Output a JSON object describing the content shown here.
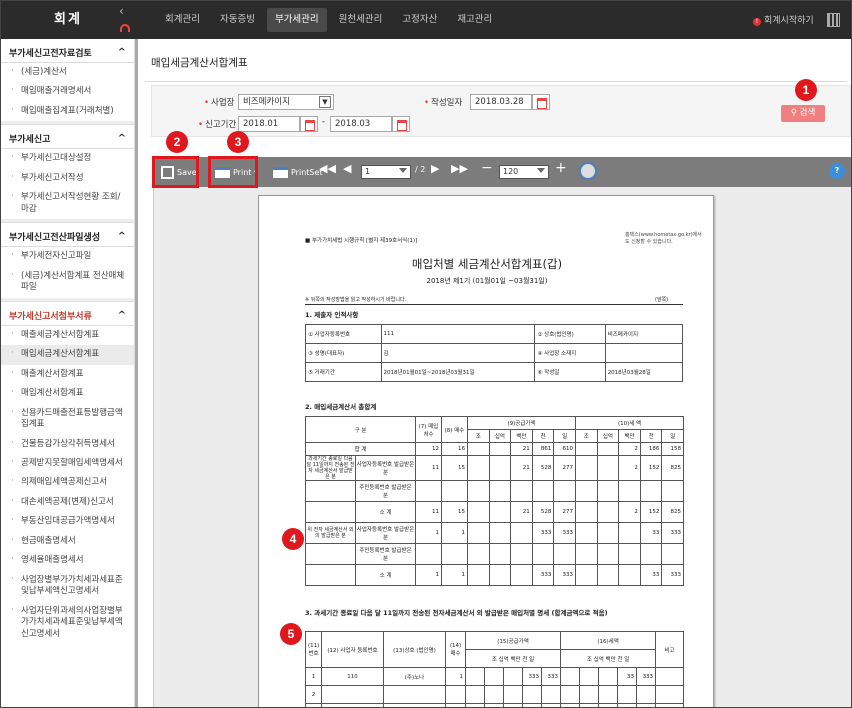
{
  "app": {
    "logo": "회계",
    "start_label": "회계시작하기"
  },
  "topnav": [
    {
      "label": "회계관리"
    },
    {
      "label": "자동증빙"
    },
    {
      "label": "부가세관리"
    },
    {
      "label": "원천세관리"
    },
    {
      "label": "고정자산"
    },
    {
      "label": "재고관리"
    }
  ],
  "topnav_active": "부가세관리",
  "sidebar": [
    {
      "title": "부가세신고전자료검토",
      "items": [
        "(세금)계산서",
        "매입매출거래명세서",
        "매입매출집계표(거래처별)"
      ]
    },
    {
      "title": "부가세신고",
      "items": [
        "부가세신고대상설정",
        "부가세신고서작성",
        "부가세신고서작성현황 조회/마감"
      ]
    },
    {
      "title": "부가세신고전산파일생성",
      "items": [
        "부가세전자신고파일",
        "(세금)계산서합계표 전산매체파일"
      ]
    },
    {
      "title": "부가세신고서첨부서류",
      "items": [
        "매출세금계산서합계표",
        "매입세금계산서합계표",
        "매출계산서합계표",
        "매입계산서합계표",
        "신용카드매출전표등발행금액집계표",
        "건물등감가상각취득명세서",
        "공제받지못할매입세액명세서",
        "의제매입세액공제신고서",
        "대손세액공제(변제)신고서",
        "부동산임대공급가액명세서",
        "현금매출명세서",
        "영세율매출명세서",
        "사업장별부가가치세과세표준및납부세액신고명세서",
        "사업자단위과세의사업장별부가가치세과세표준및납부세액신고명세서"
      ]
    }
  ],
  "sidebar_active": "매입세금계산서합계표",
  "page_title": "매입세금계산서합계표",
  "filter": {
    "business_label": "사업장",
    "business_value": "비즈메카이지",
    "date_label": "작성일자",
    "date_value": "2018.03.28",
    "period_label": "신고기간",
    "period_from": "2018.01",
    "period_to": "2018.03",
    "search_label": "검색"
  },
  "viewer": {
    "save_label": "Save",
    "print_label": "Print",
    "printset_label": "PrintSet",
    "page_value": "1",
    "page_total": "/ 2",
    "zoom_value": "120"
  },
  "markers": [
    "1",
    "2",
    "3",
    "4",
    "5"
  ],
  "doc": {
    "law": "■ 부가가치세법 시행규칙 [별지 제39호서식(1)]",
    "hometax": "홈택스(www.hometax.go.kr)에서도 신청할 수 있습니다.",
    "title": "매입처별 세금계산서합계표(갑)",
    "subtitle": "2018년 제1기 (01월01일 ~03월31일)",
    "note": "※ 뒤쪽의 작성방법을 읽고 작성하시기 바랍니다.",
    "page": "(앞쪽)",
    "sec1": "1. 제출자 인적사항",
    "r1": [
      "① 사업자등록번호",
      "111",
      "② 상호(법인명)",
      "비즈메카이지"
    ],
    "r2": [
      "③ 성명(대표자)",
      "김",
      "④ 사업장 소재지",
      ""
    ],
    "r3": [
      "⑤ 거래기간",
      "2018년01월01일~2018년03월31일",
      "⑥ 작성일",
      "2018년03월28일"
    ],
    "sec2": "2. 매입세금계산서 총합계",
    "h_gubun": "구 분",
    "h7": "(7) 매입 처수",
    "h8": "(8) 매수",
    "h9": "(9)공급가액",
    "h10": "(10)세 액",
    "units": [
      "조",
      "십억",
      "백만",
      "천",
      "일",
      "조",
      "십억",
      "백만",
      "천",
      "일"
    ],
    "total_label": "합 계",
    "g1": "과세기간 종료일 다음 달 11일까지 전송된 전자 세금계산서 발급받은 분",
    "g2": "위 전자 세금계산서 외의 발급받은 분",
    "sub_a": "사업자등록번호 발급받은 분",
    "sub_b": "주민등록번호 발급받은 분",
    "sub_c": "소 계",
    "rows": [
      {
        "c7": "12",
        "c8": "16",
        "v": [
          "",
          "",
          "21",
          "861",
          "610"
        ],
        "t": [
          "",
          "",
          "2",
          "186",
          "158"
        ]
      },
      {
        "c7": "11",
        "c8": "15",
        "v": [
          "",
          "",
          "21",
          "528",
          "277"
        ],
        "t": [
          "",
          "",
          "2",
          "152",
          "825"
        ]
      },
      {
        "c7": "",
        "c8": "",
        "v": [
          "",
          "",
          "",
          "",
          ""
        ],
        "t": [
          "",
          "",
          "",
          "",
          ""
        ]
      },
      {
        "c7": "11",
        "c8": "15",
        "v": [
          "",
          "",
          "21",
          "528",
          "277"
        ],
        "t": [
          "",
          "",
          "2",
          "152",
          "825"
        ]
      },
      {
        "c7": "1",
        "c8": "1",
        "v": [
          "",
          "",
          "",
          "333",
          "333"
        ],
        "t": [
          "",
          "",
          "",
          "33",
          "333"
        ]
      },
      {
        "c7": "",
        "c8": "",
        "v": [
          "",
          "",
          "",
          "",
          ""
        ],
        "t": [
          "",
          "",
          "",
          "",
          ""
        ]
      },
      {
        "c7": "1",
        "c8": "1",
        "v": [
          "",
          "",
          "",
          "333",
          "333"
        ],
        "t": [
          "",
          "",
          "",
          "33",
          "333"
        ]
      }
    ],
    "sec3": "3. 과세기간 종료일 다음 달 11일까지 전송된 전자세금계산서 외 발급받은 매입처별 명세 (합계금액으로 적음)",
    "t3h": [
      "(11)번호",
      "(12) 사업자 등록번호",
      "(13)상호 (법인명)",
      "(14) 매수",
      "(15)공급가액",
      "(16)세액",
      "비고"
    ],
    "t3units": "조 십억 백만 천 일",
    "t3rows": [
      {
        "no": "1",
        "reg": "110",
        "name": "(주)노나",
        "cnt": "1",
        "v": [
          "",
          "",
          "",
          "333",
          "333"
        ],
        "t": [
          "",
          "",
          "",
          "33",
          "333"
        ]
      },
      {
        "no": "2",
        "reg": "",
        "name": "",
        "cnt": "",
        "v": [
          "",
          "",
          "",
          "",
          ""
        ],
        "t": [
          "",
          "",
          "",
          "",
          ""
        ]
      },
      {
        "no": "3",
        "reg": "",
        "name": "",
        "cnt": "",
        "v": [
          "",
          "",
          "",
          "",
          ""
        ],
        "t": [
          "",
          "",
          "",
          "",
          ""
        ]
      }
    ]
  }
}
